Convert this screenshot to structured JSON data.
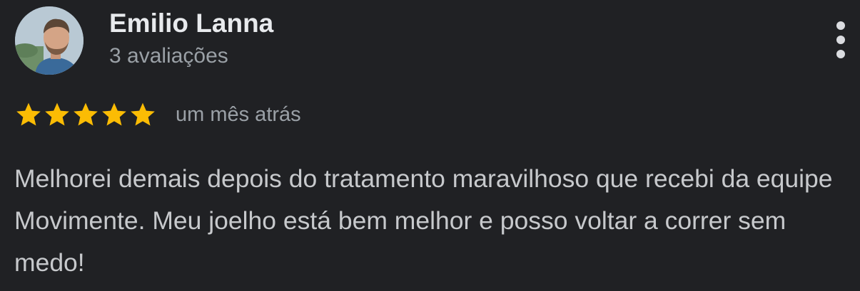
{
  "review": {
    "author_name": "Emilio Lanna",
    "author_reviews": "3 avaliações",
    "rating": 5,
    "rating_max": 5,
    "date": "um mês atrás",
    "text": "Melhorei demais depois do tratamento maravilhoso que recebi da equipe Movimente. Meu joelho está bem melhor e posso voltar a correr sem medo!"
  },
  "icons": {
    "more": "more-vert-icon",
    "star": "star-icon"
  },
  "colors": {
    "background": "#202124",
    "star": "#fbbc04",
    "name": "#e8eaed",
    "secondary_text": "#9aa0a6",
    "body_text": "#c7c9cc"
  }
}
